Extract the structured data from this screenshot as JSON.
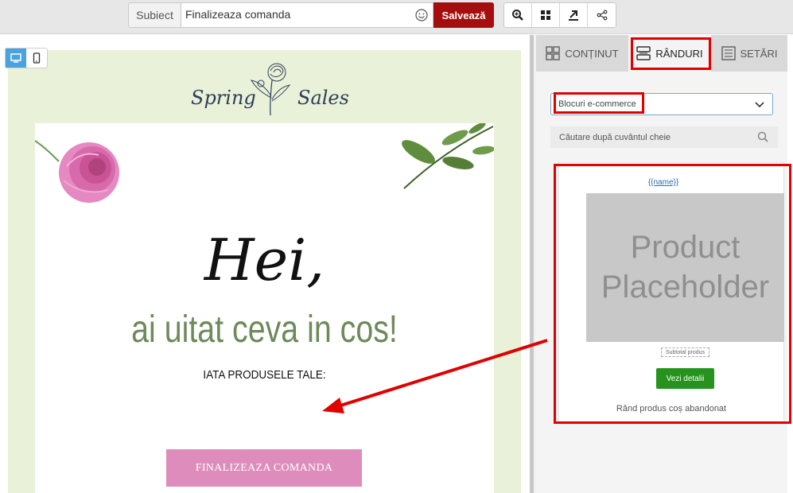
{
  "toolbar": {
    "subject_label": "Subiect",
    "subject_value": "Finalizeaza comanda",
    "save_label": "Salvează",
    "tools": [
      "zoom-icon",
      "blocks-icon",
      "export-icon",
      "share-icon"
    ]
  },
  "device": {
    "active": "desktop"
  },
  "email": {
    "logo_left": "Spring",
    "logo_right": "Sales",
    "headline": "Hei,",
    "subheadline": "ai uitat ceva in cos!",
    "products_title": "IATA PRODUSELE TALE:",
    "cta_label": "FINALIZEAZA COMANDA"
  },
  "panel": {
    "tabs": [
      {
        "label": "CONȚINUT",
        "icon": "grid-icon"
      },
      {
        "label": "RÂNDURI",
        "icon": "rows-icon"
      },
      {
        "label": "SETĂRI",
        "icon": "settings-icon"
      }
    ],
    "active_tab": "RÂNDURI",
    "category_select": "Blocuri e-commerce",
    "search_placeholder": "Căutare după cuvântul cheie",
    "block": {
      "name_tag": "{{name}}",
      "placeholder_text": "Product Placeholder",
      "subtotal_label": "Subtotal produs",
      "button_label": "Vezi detalii",
      "label": "Rând produs coș abandonat"
    }
  },
  "colors": {
    "save_button": "#a50e0e",
    "cta": "#de8cbc",
    "email_background": "#e9f1d8",
    "highlight": "#e00000",
    "details_button": "#27931f",
    "subheadline": "#6d8a5a"
  }
}
